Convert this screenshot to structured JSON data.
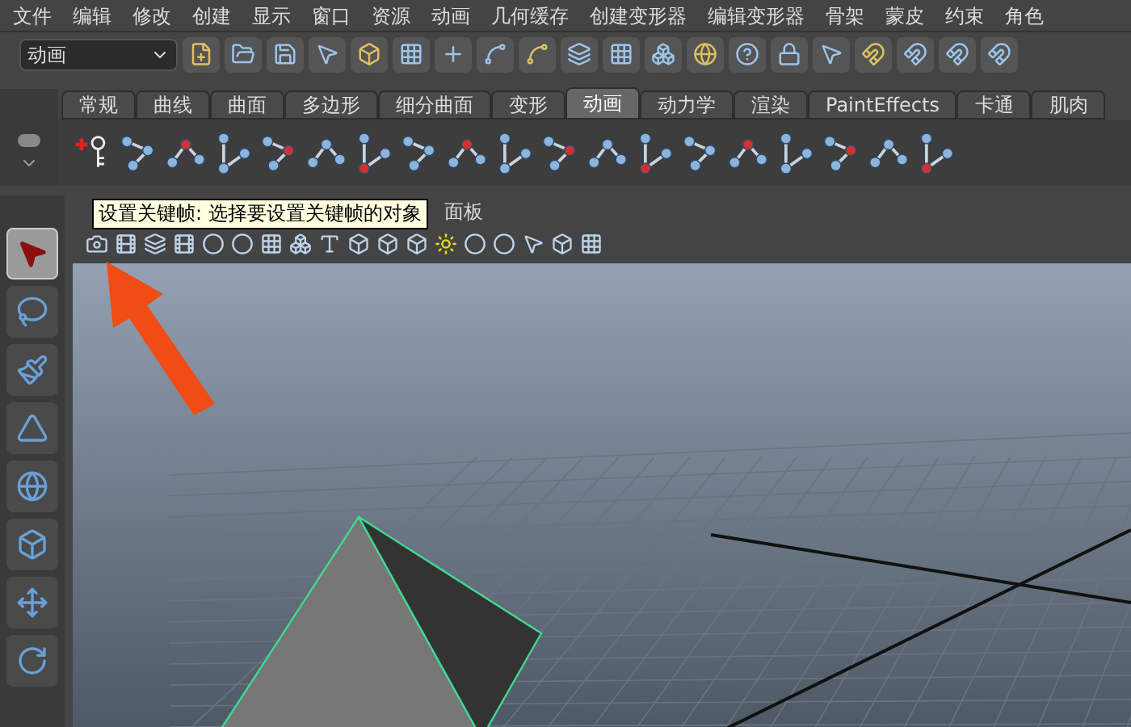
{
  "menu_bar": {
    "items": [
      "文件",
      "编辑",
      "修改",
      "创建",
      "显示",
      "窗口",
      "资源",
      "动画",
      "几何缓存",
      "创建变形器",
      "编辑变形器",
      "骨架",
      "蒙皮",
      "约束",
      "角色"
    ]
  },
  "status_line": {
    "mode_dropdown": "动画"
  },
  "shelf": {
    "tabs": [
      {
        "label": "常规",
        "selected": false
      },
      {
        "label": "曲线",
        "selected": false
      },
      {
        "label": "曲面",
        "selected": false
      },
      {
        "label": "多边形",
        "selected": false
      },
      {
        "label": "细分曲面",
        "selected": false
      },
      {
        "label": "变形",
        "selected": false
      },
      {
        "label": "动画",
        "selected": true
      },
      {
        "label": "动力学",
        "selected": false
      },
      {
        "label": "渲染",
        "selected": false
      },
      {
        "label": "PaintEffects",
        "selected": false
      },
      {
        "label": "卡通",
        "selected": false
      },
      {
        "label": "肌肉",
        "selected": false
      }
    ]
  },
  "tooltip": "设置关键帧: 选择要设置关键帧的对象",
  "panel_menu": [
    "面板"
  ],
  "toolbox": {
    "tools": [
      {
        "selected": true
      },
      {
        "selected": false
      },
      {
        "selected": false
      },
      {
        "selected": false
      },
      {
        "selected": false
      },
      {
        "selected": false
      },
      {
        "selected": false
      },
      {
        "selected": false
      }
    ]
  }
}
